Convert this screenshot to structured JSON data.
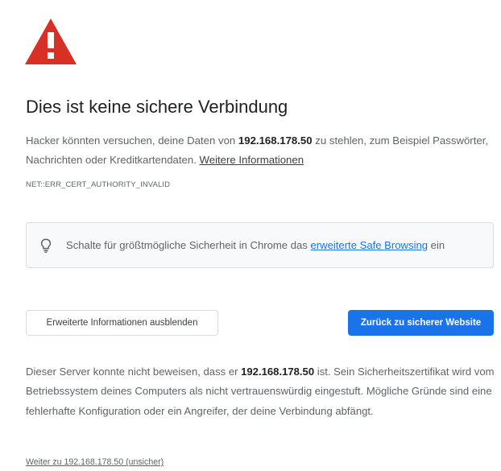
{
  "interstitial": {
    "heading": "Dies ist keine sichere Verbindung",
    "intro": {
      "before_host": "Hacker könnten versuchen, deine Daten von ",
      "host": "192.168.178.50",
      "after_host": " zu stehlen, zum Beispiel Passwörter, Nachrichten oder Kreditkartendaten. ",
      "learn_more_link": "Weitere Informationen"
    },
    "error_code": "NET::ERR_CERT_AUTHORITY_INVALID"
  },
  "safe_browsing_promo": {
    "before_link": "Schalte für größtmögliche Sicherheit in Chrome das ",
    "link": "erweiterte Safe Browsing",
    "after_link": " ein"
  },
  "buttons": {
    "details_toggle": "Erweiterte Informationen ausblenden",
    "back_to_safety": "Zurück zu sicherer Website"
  },
  "details": {
    "before_host": "Dieser Server konnte nicht beweisen, dass er ",
    "host": "192.168.178.50",
    "after_host": " ist. Sein Sicherheitszertifikat wird vom Betriebssystem deines Computers als nicht vertrauenswürdig eingestuft. Mögliche Gründe sind eine fehlerhafte Konfiguration oder ein Angreifer, der deine Verbindung abfängt."
  },
  "proceed_link": "Weiter zu 192.168.178.50 (unsicher)",
  "colors": {
    "warning_red": "#d93025",
    "primary_blue": "#1a73e8",
    "text_secondary": "#5f6368"
  },
  "icons": {
    "warning": "warning-triangle-icon",
    "bulb": "lightbulb-icon"
  }
}
